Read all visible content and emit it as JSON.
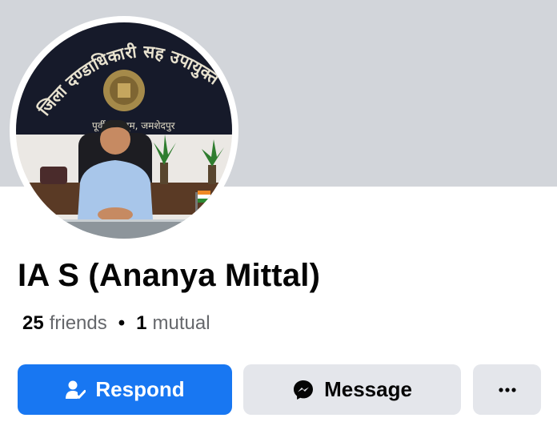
{
  "profile": {
    "name": "IA S (Ananya Mittal)",
    "friends_count": "25",
    "friends_label": "friends",
    "separator": "•",
    "mutual_count": "1",
    "mutual_label": "mutual",
    "photo_nameplate": "जिला दण्डाधिकारी सह उपायुक्त",
    "photo_subtitle": "पूर्वी सिंहभूम, जमशेदपुर"
  },
  "actions": {
    "respond_label": "Respond",
    "respond_icon": "person-check-icon",
    "message_label": "Message",
    "message_icon": "messenger-icon",
    "more_icon": "more-dots-icon"
  },
  "colors": {
    "primary": "#1877f2",
    "secondary_button": "#e4e6eb",
    "cover": "#d2d5da",
    "text": "#050505",
    "muted_text": "#65676b"
  }
}
